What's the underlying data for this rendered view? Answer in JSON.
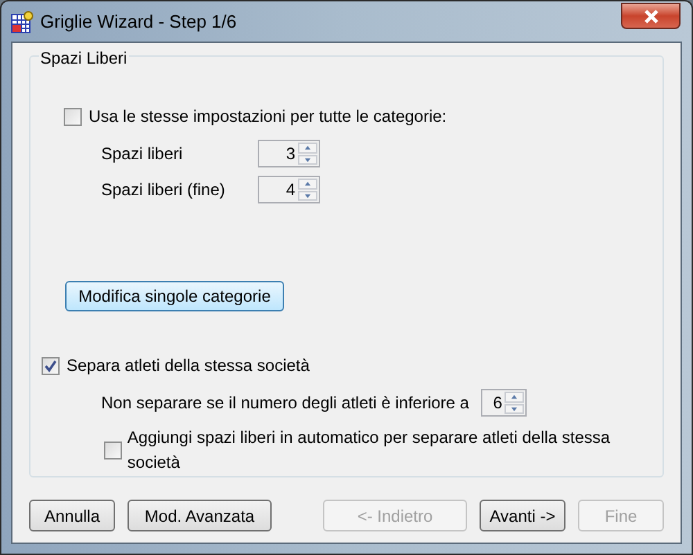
{
  "window": {
    "title": "Griglie Wizard - Step 1/6"
  },
  "group": {
    "title": "Spazi Liberi"
  },
  "same_settings": {
    "label": "Usa le stesse impostazioni per tutte le categorie:",
    "checked": false
  },
  "spinners": [
    {
      "label": "Spazi liberi",
      "value": "3"
    },
    {
      "label": "Spazi liberi (fine)",
      "value": "4"
    }
  ],
  "edit_button": "Modifica singole categorie",
  "separate": {
    "label": "Separa atleti della stessa società",
    "checked": true
  },
  "threshold": {
    "label": "Non separare se il numero degli atleti è inferiore a",
    "value": "6"
  },
  "auto_add": {
    "label": "Aggiungi spazi liberi in automatico per separare atleti della stessa società",
    "checked": false
  },
  "footer_buttons": [
    {
      "label": "Annulla",
      "disabled": false,
      "kind": "left"
    },
    {
      "label": "Mod. Avanzata",
      "disabled": false,
      "kind": "left"
    },
    {
      "label": "<- Indietro",
      "disabled": true,
      "kind": "right"
    },
    {
      "label": "Avanti ->",
      "disabled": false,
      "kind": "right"
    },
    {
      "label": "Fine",
      "disabled": true,
      "kind": "right"
    }
  ]
}
